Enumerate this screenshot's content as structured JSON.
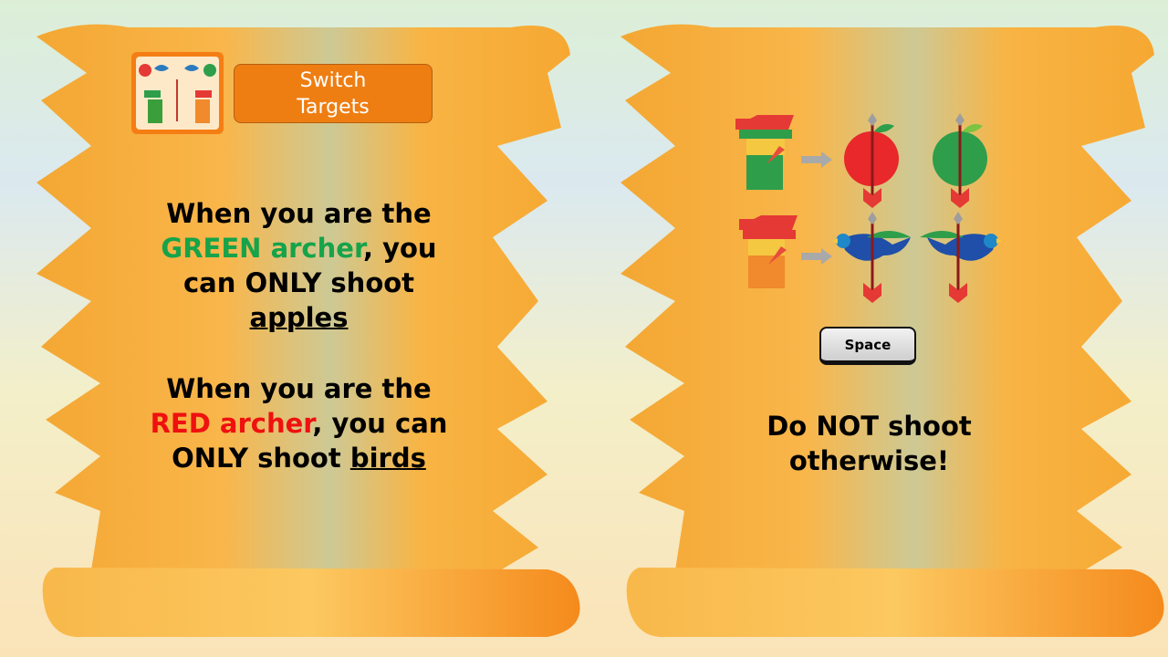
{
  "left_panel": {
    "switch_button": {
      "line1": "Switch",
      "line2": "Targets"
    },
    "rule_green": {
      "line1": "When you are the",
      "color_word": "GREEN",
      "archer_word": "archer",
      "line2_tail": ", you",
      "line3": "can ONLY shoot",
      "target": "apples"
    },
    "rule_red": {
      "line1": "When you are the",
      "color_word": "RED",
      "archer_word": "archer",
      "line2_tail": ", you can",
      "line3_head": "ONLY shoot ",
      "target": "birds"
    }
  },
  "right_panel": {
    "space_key_label": "Space",
    "warning": {
      "line1": "Do NOT shoot",
      "line2": "otherwise!"
    }
  },
  "colors": {
    "scroll": "#f7ad3a",
    "scroll_center": "#ccc890",
    "green_text": "#16a34a",
    "red_text": "#ef1010",
    "button": "#ee7e12"
  }
}
